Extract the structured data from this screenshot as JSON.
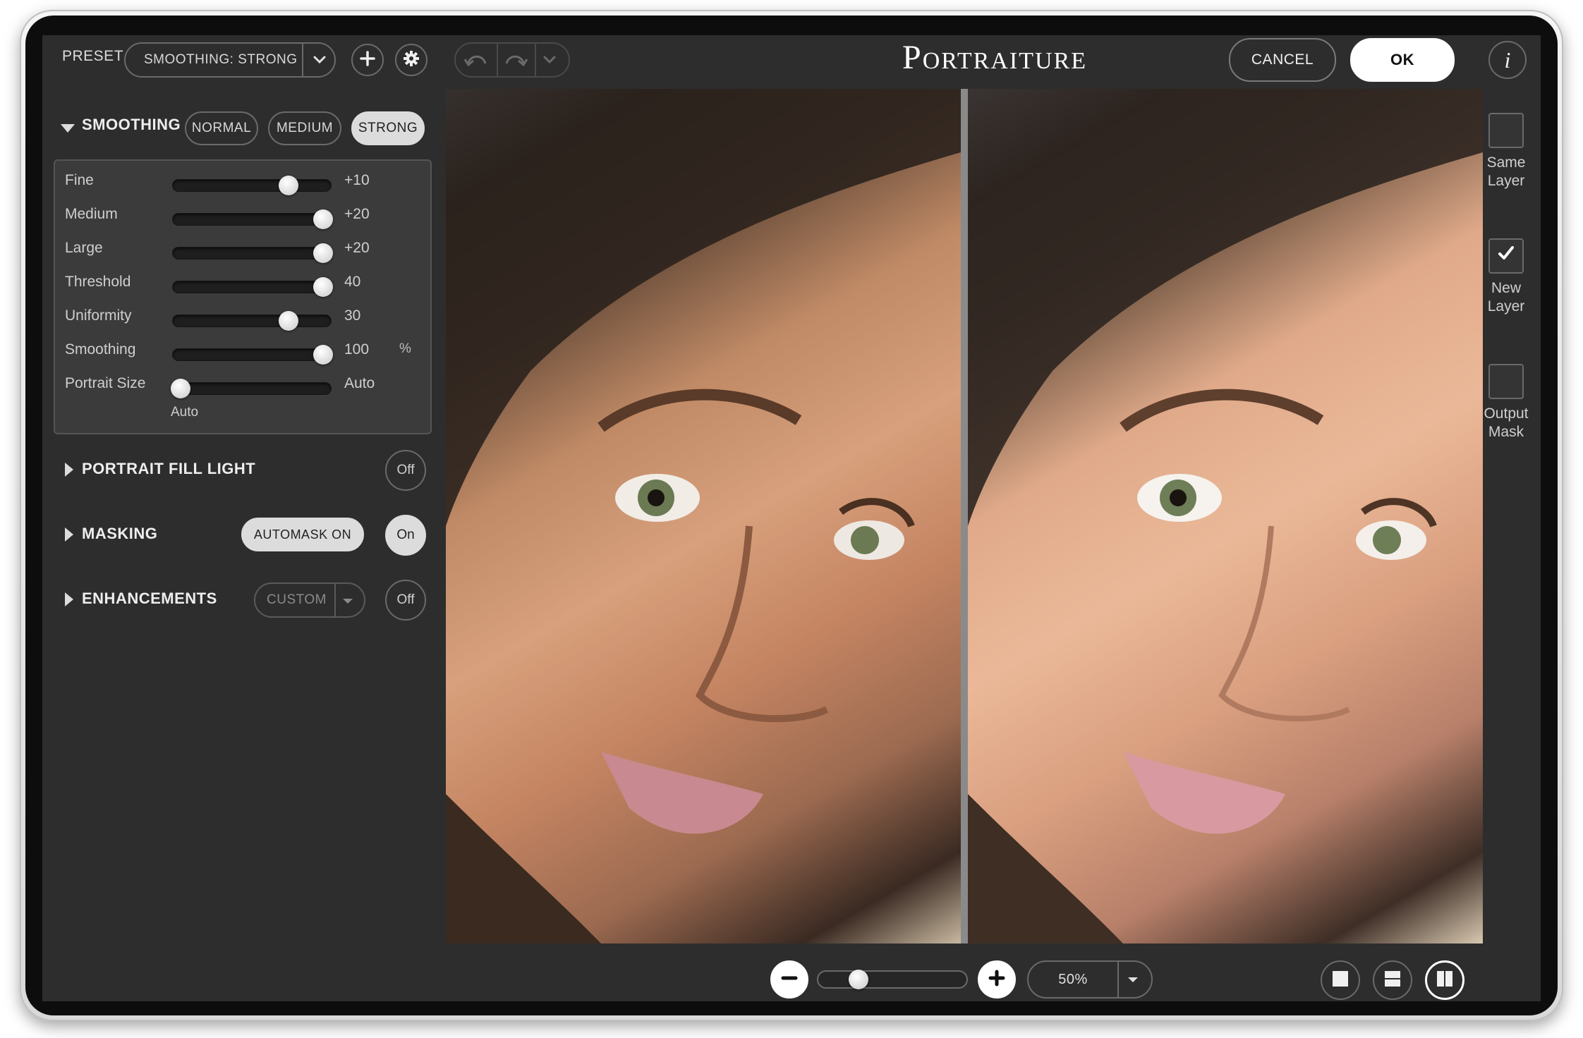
{
  "app": {
    "title": "Portraiture"
  },
  "header": {
    "preset_label": "PRESET",
    "preset_value": "SMOOTHING: STRONG",
    "cancel_label": "CANCEL",
    "ok_label": "OK",
    "info_glyph": "i"
  },
  "smoothing": {
    "title": "SMOOTHING",
    "modes": [
      "NORMAL",
      "MEDIUM",
      "STRONG"
    ],
    "active_mode": "STRONG",
    "sliders": [
      {
        "label": "Fine",
        "value": "+10",
        "position": 0.73,
        "unit": ""
      },
      {
        "label": "Medium",
        "value": "+20",
        "position": 0.95,
        "unit": ""
      },
      {
        "label": "Large",
        "value": "+20",
        "position": 0.95,
        "unit": ""
      },
      {
        "label": "Threshold",
        "value": "40",
        "position": 0.95,
        "unit": ""
      },
      {
        "label": "Uniformity",
        "value": "30",
        "position": 0.73,
        "unit": ""
      },
      {
        "label": "Smoothing",
        "value": "100",
        "position": 0.95,
        "unit": "%"
      },
      {
        "label": "Portrait Size",
        "value": "Auto",
        "position": 0.05,
        "unit": ""
      }
    ],
    "portrait_size_caption": "Auto"
  },
  "sections": {
    "fill_light": {
      "title": "PORTRAIT FILL LIGHT",
      "toggle": "Off"
    },
    "masking": {
      "title": "MASKING",
      "automask_label": "AUTOMASK ON",
      "toggle": "On"
    },
    "enhancements": {
      "title": "ENHANCEMENTS",
      "preset": "CUSTOM",
      "toggle": "Off"
    }
  },
  "output": {
    "same_layer": {
      "line1": "Same",
      "line2": "Layer",
      "checked": false
    },
    "new_layer": {
      "line1": "New",
      "line2": "Layer",
      "checked": true
    },
    "output_mask": {
      "line1": "Output",
      "line2": "Mask",
      "checked": false
    }
  },
  "footer": {
    "zoom": "50%",
    "zoom_slider_position": 0.27
  },
  "colors": {
    "app_bg": "#2d2d2d",
    "panel_bg": "#3b3b3b",
    "active_pill": "#dcdcdc",
    "ok_button": "#ffffff"
  },
  "icons": {
    "plus": "plus-icon",
    "gear": "gear-icon",
    "undo": "undo-icon",
    "redo": "redo-icon",
    "history": "chevron-down-icon",
    "info": "info-icon",
    "zoom_out": "minus-icon",
    "zoom_in": "plus-icon",
    "view_single": "single-view-icon",
    "view_split_h": "split-horizontal-icon",
    "view_split_v": "split-vertical-icon"
  }
}
